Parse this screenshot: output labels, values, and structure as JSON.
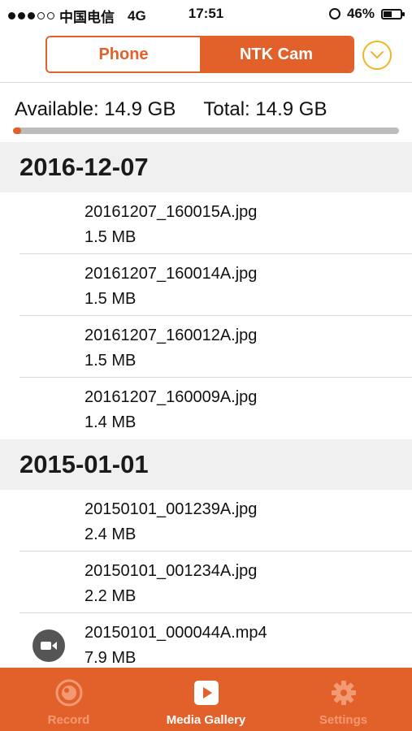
{
  "status_bar": {
    "carrier": "中国电信",
    "network": "4G",
    "time": "17:51",
    "battery_percent": "46%",
    "battery_level": 0.46
  },
  "segment": {
    "phone_label": "Phone",
    "cam_label": "NTK Cam",
    "active": "NTK Cam",
    "dropdown_icon": "chevron-down-icon"
  },
  "storage": {
    "available": "Available: 14.9 GB",
    "total": "Total: 14.9 GB",
    "used_fraction": 0.02
  },
  "sections": [
    {
      "date": "2016-12-07",
      "files": [
        {
          "name": "20161207_160015A.jpg",
          "size": "1.5 MB"
        },
        {
          "name": "20161207_160014A.jpg",
          "size": "1.5 MB"
        },
        {
          "name": "20161207_160012A.jpg",
          "size": "1.5 MB"
        },
        {
          "name": "20161207_160009A.jpg",
          "size": "1.4 MB"
        }
      ]
    },
    {
      "date": "2015-01-01",
      "files": [
        {
          "name": "20150101_001239A.jpg",
          "size": "2.4 MB"
        },
        {
          "name": "20150101_001234A.jpg",
          "size": "2.2 MB"
        },
        {
          "name": "20150101_000044A.mp4",
          "size": "7.9 MB"
        }
      ]
    }
  ],
  "tabs": [
    {
      "label": "Record",
      "icon": "record-icon"
    },
    {
      "label": "Media Gallery",
      "icon": "play-icon"
    },
    {
      "label": "Settings",
      "icon": "gear-icon"
    }
  ],
  "active_tab": "Media Gallery",
  "colors": {
    "accent": "#e2602a",
    "dropdown_ring": "#f0b429"
  }
}
